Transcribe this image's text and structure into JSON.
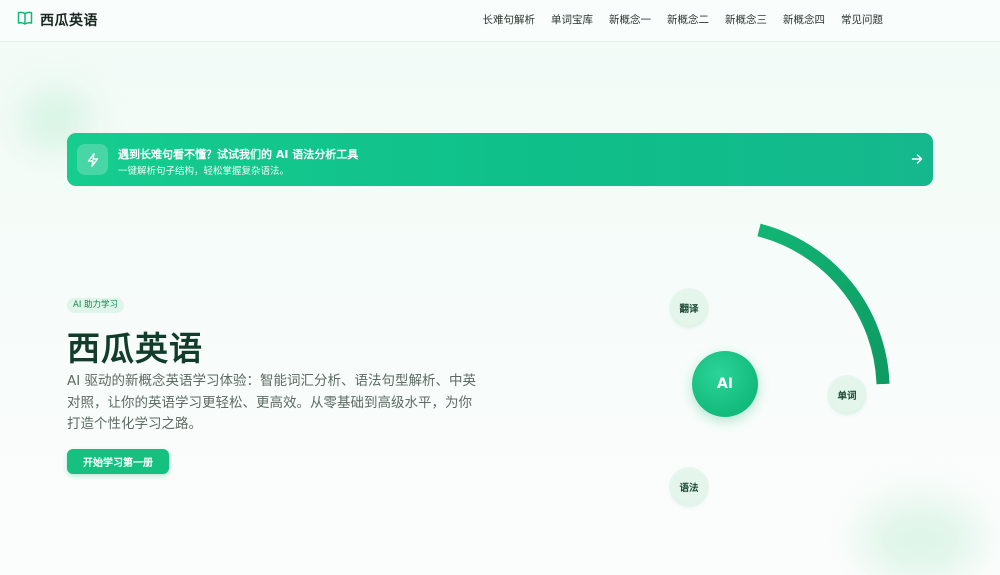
{
  "header": {
    "logo_text": "西瓜英语",
    "nav": [
      "长难句解析",
      "单词宝库",
      "新概念一",
      "新概念二",
      "新概念三",
      "新概念四",
      "常见问题"
    ]
  },
  "banner": {
    "title": "遇到长难句看不懂？试试我们的 AI 语法分析工具",
    "subtitle": "一键解析句子结构，轻松掌握复杂语法。"
  },
  "hero": {
    "badge": "AI 助力学习",
    "title": "西瓜英语",
    "description": "AI 驱动的新概念英语学习体验：智能词汇分析、语法句型解析、中英对照，让你的英语学习更轻松、更高效。从零基础到高级水平，为你打造个性化学习之路。",
    "cta_label": "开始学习第一册"
  },
  "graphic": {
    "center_label": "AI",
    "nodes": [
      "翻译",
      "单词",
      "语法"
    ]
  },
  "colors": {
    "accent": "#15c081",
    "banner_start": "#16cc8e",
    "title_dark": "#123d2c"
  }
}
